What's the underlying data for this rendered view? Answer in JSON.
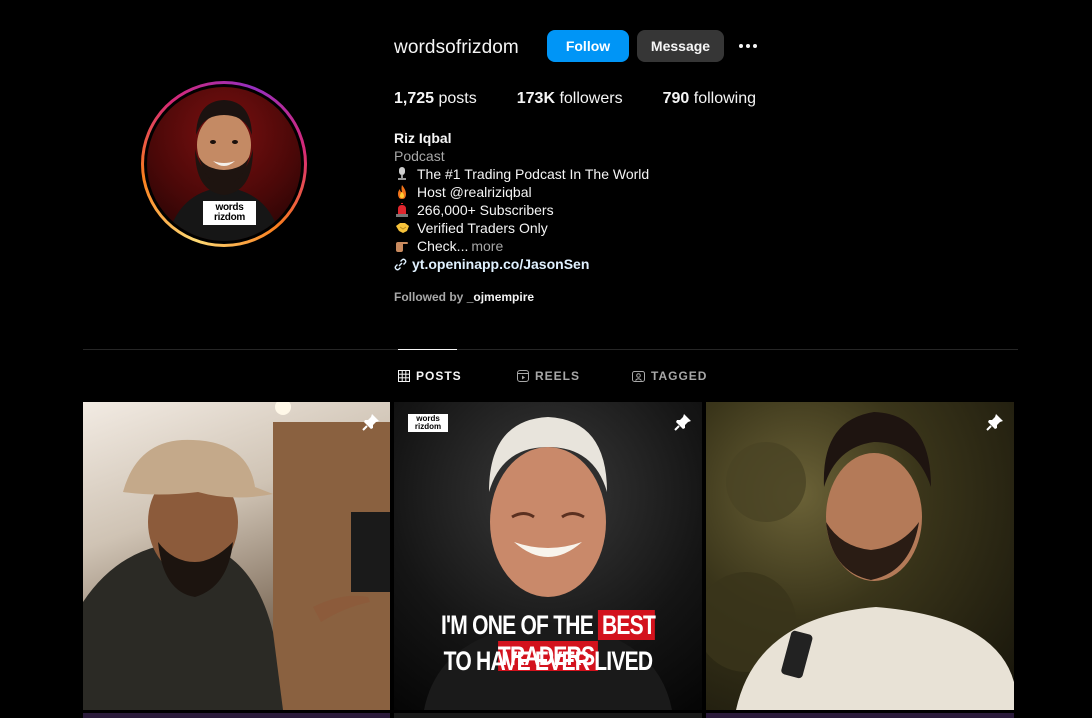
{
  "profile": {
    "username": "wordsofrizdom",
    "follow_label": "Follow",
    "message_label": "Message",
    "avatar_brand": "words rizdom",
    "stats": {
      "posts_count": "1,725",
      "posts_label": "posts",
      "followers_count": "173K",
      "followers_label": "followers",
      "following_count": "790",
      "following_label": "following"
    },
    "bio": {
      "full_name": "Riz Iqbal",
      "category": "Podcast",
      "lines": [
        {
          "emoji": "microphone",
          "text": "The #1 Trading Podcast In The World"
        },
        {
          "emoji": "fire",
          "text": "Host @realriziqbal"
        },
        {
          "emoji": "siren",
          "text": "266,000+ Subscribers"
        },
        {
          "emoji": "handshake",
          "text": "Verified Traders Only"
        },
        {
          "emoji": "pointing-hand",
          "text": "Check..."
        }
      ],
      "more_label": "more",
      "link": "yt.openinapp.co/JasonSen"
    },
    "followed_by_prefix": "Followed by",
    "followed_by_account": "_ojmempire"
  },
  "tabs": [
    {
      "label": "POSTS",
      "icon": "grid-icon",
      "active": true
    },
    {
      "label": "REELS",
      "icon": "reels-icon",
      "active": false
    },
    {
      "label": "TAGGED",
      "icon": "tagged-icon",
      "active": false
    }
  ],
  "posts": [
    {
      "pinned": true,
      "caption": ""
    },
    {
      "pinned": true,
      "brand": "words rizdom",
      "caption_line1_a": "I'M ONE OF THE",
      "caption_line1_b": "BEST TRADERS",
      "caption_line2": "TO HAVE EVER LIVED"
    },
    {
      "pinned": true,
      "caption": ""
    }
  ],
  "colors": {
    "follow_button": "#0095f6",
    "message_button": "#363636",
    "caption_highlight": "#d3121d"
  }
}
